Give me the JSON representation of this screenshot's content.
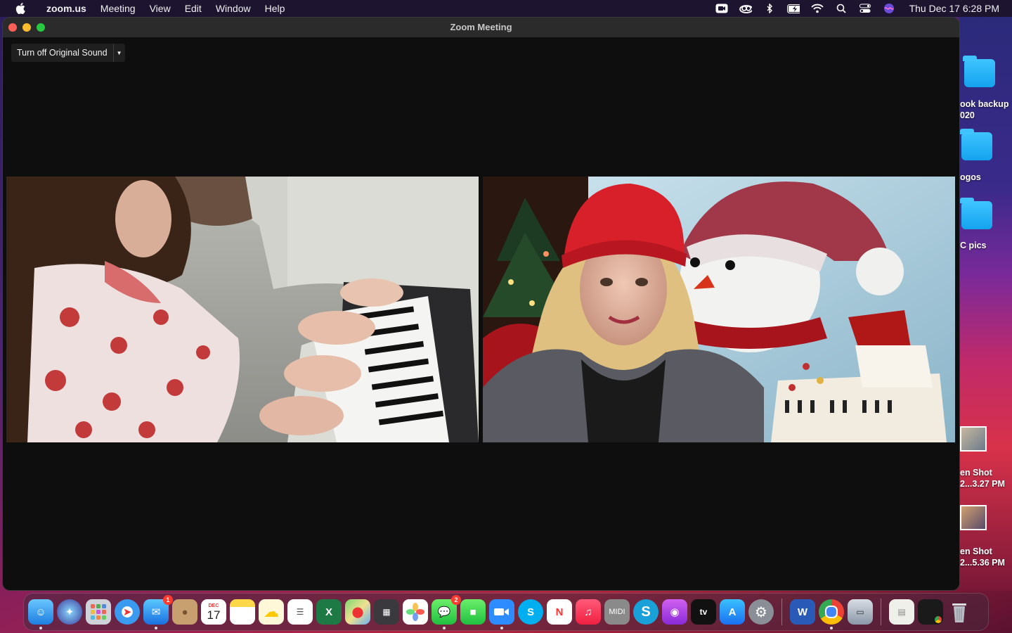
{
  "menubar": {
    "app_name": "zoom.us",
    "items": [
      "Meeting",
      "View",
      "Edit",
      "Window",
      "Help"
    ],
    "clock": "Thu Dec 17  6:28 PM"
  },
  "window": {
    "title": "Zoom Meeting",
    "original_sound_label": "Turn off Original Sound"
  },
  "desktop": {
    "items": [
      {
        "line1": "ook backup",
        "line2": "020"
      },
      {
        "line1": "ogos",
        "line2": ""
      },
      {
        "line1": "C pics",
        "line2": ""
      },
      {
        "line1": "en Shot",
        "line2": "2...3.27 PM"
      },
      {
        "line1": "en Shot",
        "line2": "2...5.36 PM"
      }
    ]
  },
  "dock": {
    "mail_badge": "1",
    "messages_badge": "2",
    "calendar_month": "DEC",
    "calendar_day": "17",
    "midi_label": "MIDI",
    "tv_label": "tv",
    "excel_label": "X",
    "word_label": "W",
    "skype_label": "S"
  },
  "colors": {
    "window_bg": "#0e0e0e",
    "titlebar": "#2b2b2b",
    "close": "#ff5f57",
    "minimize": "#febc2e",
    "maximize": "#28c840"
  }
}
